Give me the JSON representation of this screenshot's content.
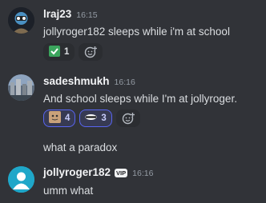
{
  "messages": [
    {
      "username": "lraj23",
      "time": "16:15",
      "text": "jollyroger182 sleeps while i'm at school",
      "reactions": [
        {
          "emoji": "check-mark-emoji",
          "count": "1"
        }
      ]
    },
    {
      "username": "sadeshmukh",
      "time": "16:16",
      "text": "And school sleeps while I'm at jollyroger.",
      "reactions": [
        {
          "emoji": "custom-cat-emoji",
          "count": "4"
        },
        {
          "emoji": "custom-eyes-emoji",
          "count": "3"
        }
      ]
    },
    {
      "text": "what a paradox"
    },
    {
      "username": "jollyroger182",
      "badge": "VIP",
      "time": "16:16",
      "text": "umm what"
    }
  ],
  "colors": {
    "background": "#313338",
    "reaction_active": "#5865f2",
    "avatar_teal": "#1fa7c9"
  }
}
